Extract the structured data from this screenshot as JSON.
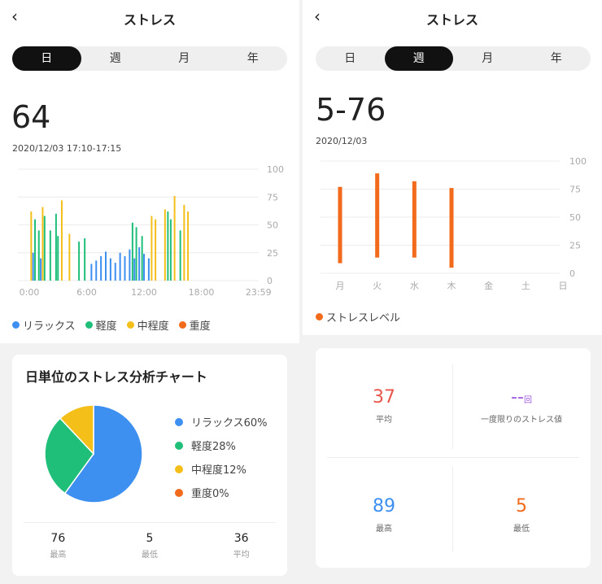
{
  "left": {
    "title": "ストレス",
    "tabs": [
      "日",
      "週",
      "月",
      "年"
    ],
    "active_tab": 0,
    "value": "64",
    "timestamp": "2020/12/03 17:10-17:15",
    "legend": [
      {
        "label": "リラックス",
        "color": "#3d8ff0"
      },
      {
        "label": "軽度",
        "color": "#1fbf7a"
      },
      {
        "label": "中程度",
        "color": "#f5bf1a"
      },
      {
        "label": "重度",
        "color": "#f26a1b"
      }
    ],
    "analysis": {
      "title": "日単位のストレス分析チャート",
      "items": [
        {
          "label": "リラックス60%",
          "color": "#3d8ff0"
        },
        {
          "label": "軽度28%",
          "color": "#1fbf7a"
        },
        {
          "label": "中程度12%",
          "color": "#f5bf1a"
        },
        {
          "label": "重度0%",
          "color": "#f26a1b"
        }
      ],
      "stats": [
        {
          "value": "76",
          "label": "最高"
        },
        {
          "value": "5",
          "label": "最低"
        },
        {
          "value": "36",
          "label": "平均"
        }
      ]
    }
  },
  "right": {
    "title": "ストレス",
    "tabs": [
      "日",
      "週",
      "月",
      "年"
    ],
    "active_tab": 1,
    "value": "5-76",
    "timestamp": "2020/12/03",
    "legend": [
      {
        "label": "ストレスレベル",
        "color": "#f26a1b"
      }
    ],
    "stats": {
      "avg": {
        "value": "37",
        "label": "平均",
        "color": "#e8564b"
      },
      "once": {
        "value": "--",
        "unit": "回",
        "label": "一度限りのストレス値",
        "color": "#9b59e0"
      },
      "max": {
        "value": "89",
        "label": "最高",
        "color": "#3d8ff0"
      },
      "min": {
        "value": "5",
        "label": "最低",
        "color": "#f26a1b"
      }
    }
  },
  "chart_data": [
    {
      "type": "bar",
      "x_tick_labels": [
        "0:00",
        "6:00",
        "12:00",
        "18:00",
        "23:59"
      ],
      "y_tick_labels": [
        "100",
        "75",
        "50",
        "25",
        "0"
      ],
      "ylim": [
        0,
        100
      ],
      "grid": true,
      "series": [
        {
          "name": "リラックス",
          "color": "#3d8ff0",
          "x": [
            0.4,
            1.2,
            6.5,
            7.0,
            7.5,
            8.0,
            8.5,
            9.0,
            9.5,
            10.0,
            10.5,
            11.0,
            11.5,
            12.0,
            12.5
          ],
          "values": [
            25,
            20,
            15,
            18,
            22,
            26,
            20,
            16,
            25,
            22,
            28,
            20,
            30,
            24,
            20
          ]
        },
        {
          "name": "軽度",
          "color": "#1fbf7a",
          "x": [
            0.6,
            1.0,
            1.6,
            2.2,
            2.8,
            3.0,
            5.2,
            5.8,
            10.8,
            11.2,
            11.8,
            14.5,
            14.8,
            15.8
          ],
          "values": [
            55,
            45,
            58,
            45,
            60,
            40,
            35,
            38,
            52,
            48,
            40,
            62,
            55,
            45
          ]
        },
        {
          "name": "中程度",
          "color": "#f5bf1a",
          "x": [
            0.2,
            1.4,
            3.4,
            4.2,
            12.8,
            13.2,
            14.2,
            15.2,
            16.2,
            16.6
          ],
          "values": [
            62,
            66,
            72,
            42,
            58,
            55,
            64,
            76,
            68,
            62
          ]
        },
        {
          "name": "重度",
          "color": "#f26a1b",
          "x": [],
          "values": []
        }
      ]
    },
    {
      "type": "bar",
      "categories": [
        "月",
        "火",
        "水",
        "木",
        "金",
        "土",
        "日"
      ],
      "y_tick_labels": [
        "100",
        "75",
        "50",
        "25",
        "0"
      ],
      "ylim": [
        0,
        100
      ],
      "grid": true,
      "series": [
        {
          "name": "ストレスレベル",
          "color": "#f26a1b",
          "ranges": [
            [
              9,
              77
            ],
            [
              14,
              89
            ],
            [
              14,
              82
            ],
            [
              5,
              76
            ],
            null,
            null,
            null
          ]
        }
      ]
    }
  ]
}
